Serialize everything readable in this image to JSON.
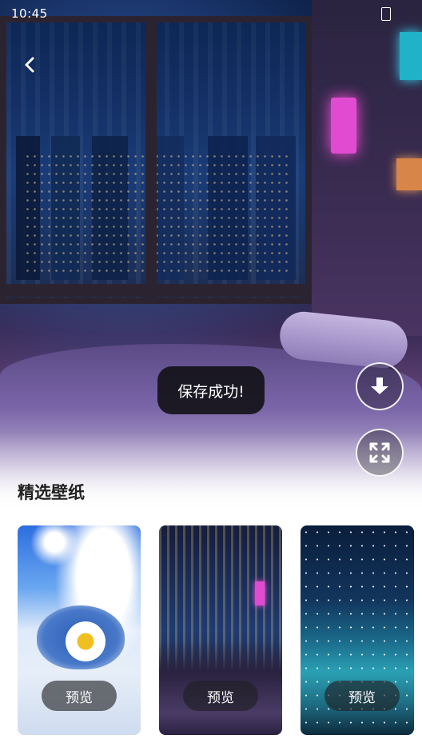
{
  "status_bar": {
    "time": "10:45"
  },
  "toast": {
    "message": "保存成功!"
  },
  "section": {
    "title": "精选壁纸"
  },
  "cards": [
    {
      "preview_label": "预览"
    },
    {
      "preview_label": "预览"
    },
    {
      "preview_label": "预览"
    }
  ],
  "icons": {
    "back": "chevron-left-icon",
    "download": "download-arrow-icon",
    "fullscreen": "expand-icon"
  },
  "colors": {
    "toast_bg": "#0f0f12",
    "title_text": "#222222",
    "preview_button_bg": "#1e1e22"
  }
}
